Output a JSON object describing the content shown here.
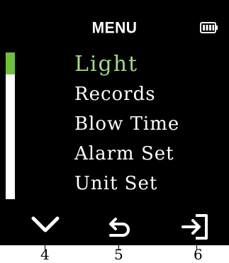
{
  "header": {
    "title": "MENU",
    "battery_icon": "battery-full-icon"
  },
  "scrollbar": {
    "position_fraction": 0.0,
    "thumb_fraction": 0.15
  },
  "menu": {
    "items": [
      {
        "label": "Light",
        "selected": true
      },
      {
        "label": "Records",
        "selected": false
      },
      {
        "label": "Blow Time",
        "selected": false
      },
      {
        "label": "Alarm Set",
        "selected": false
      },
      {
        "label": "Unit Set",
        "selected": false
      }
    ]
  },
  "softkeys": [
    {
      "icon": "chevron-down-icon",
      "number": "4"
    },
    {
      "icon": "back-arrow-icon",
      "number": "5"
    },
    {
      "icon": "enter-icon",
      "number": "6"
    }
  ],
  "colors": {
    "background": "#000000",
    "text": "#ffffff",
    "selected_text": "#a6d68a",
    "scroll_thumb": "#6fbf3d"
  }
}
